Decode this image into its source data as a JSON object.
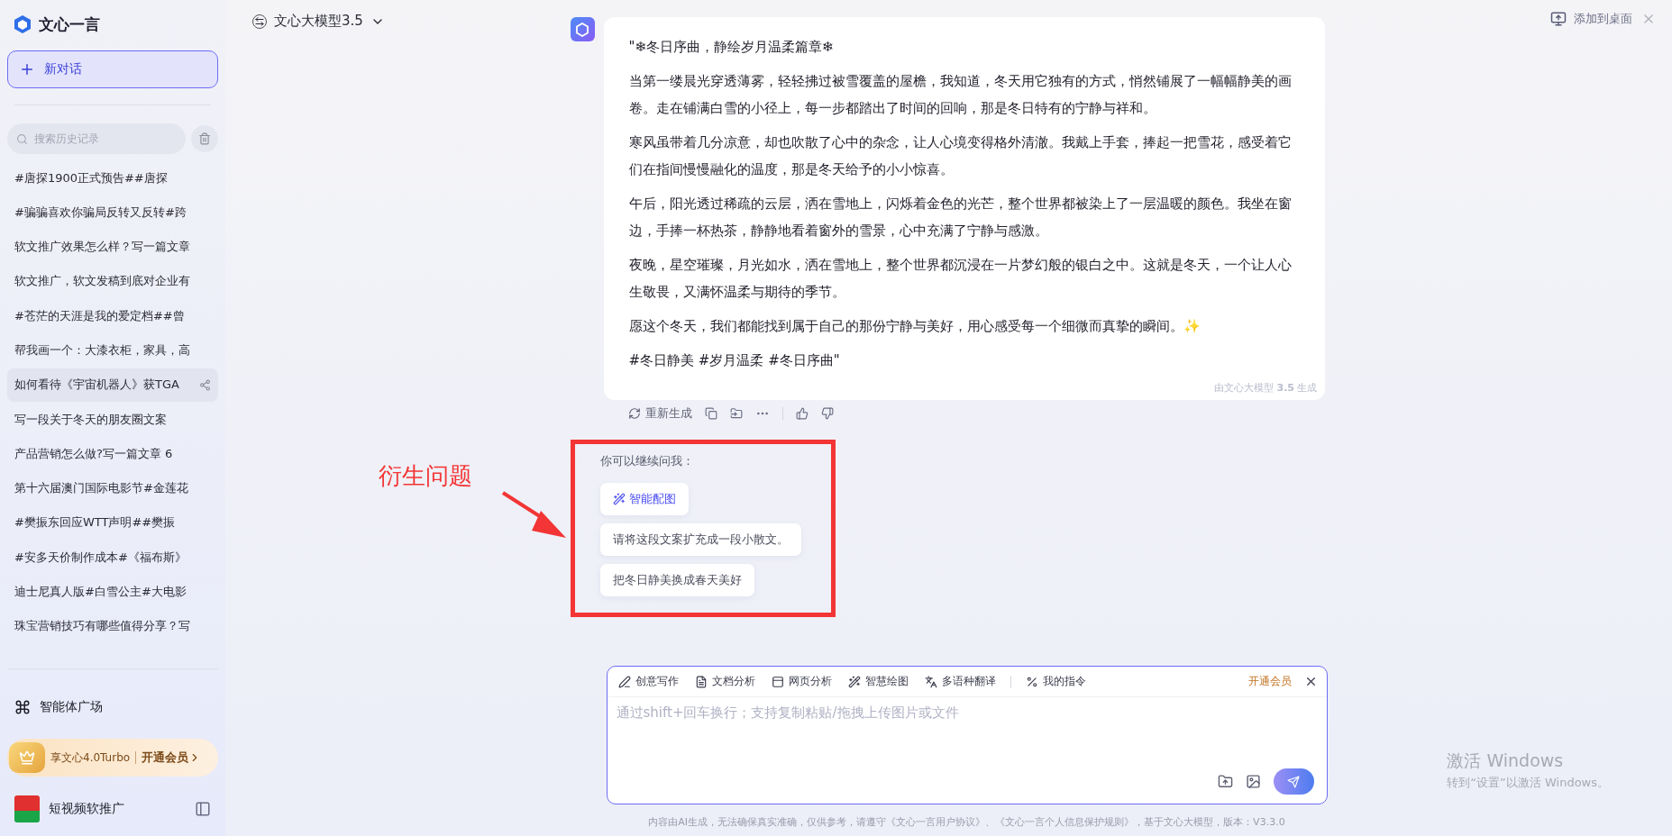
{
  "sidebar": {
    "logo_text": "文心一言",
    "new_chat": "新对话",
    "search": {
      "placeholder": "搜索历史记录"
    },
    "history": [
      {
        "label": "#唐探1900正式预告##唐探",
        "selected": false
      },
      {
        "label": "#骗骗喜欢你骗局反转又反转#跨",
        "selected": false
      },
      {
        "label": "软文推广效果怎么样？写一篇文章",
        "selected": false
      },
      {
        "label": "软文推广，软文发稿到底对企业有",
        "selected": false
      },
      {
        "label": "#苍茫的天涯是我的爱定档##曾",
        "selected": false
      },
      {
        "label": "帮我画一个：大漆衣柜，家具，高",
        "selected": false
      },
      {
        "label": "如何看待《宇宙机器人》获TGA",
        "selected": true
      },
      {
        "label": "写一段关于冬天的朋友圈文案",
        "selected": false
      },
      {
        "label": "产品营销怎么做?写一篇文章 6",
        "selected": false
      },
      {
        "label": "第十六届澳门国际电影节#金莲花",
        "selected": false
      },
      {
        "label": "#樊振东回应WTT声明##樊振",
        "selected": false
      },
      {
        "label": "#安多天价制作成本#《福布斯》",
        "selected": false
      },
      {
        "label": "迪士尼真人版#白雪公主#大电影",
        "selected": false
      },
      {
        "label": "珠宝营销技巧有哪些值得分享？写",
        "selected": false
      }
    ],
    "agent_square": "智能体广场",
    "promo": {
      "text": "享文心4.0Turbo",
      "action": "开通会员"
    },
    "user": {
      "name": "短视频软推广"
    }
  },
  "header": {
    "model": "文心大模型3.5",
    "add_desktop": "添加到桌面"
  },
  "message": {
    "paragraphs": [
      "\"❄冬日序曲，静绘岁月温柔篇章❄",
      "当第一缕晨光穿透薄雾，轻轻拂过被雪覆盖的屋檐，我知道，冬天用它独有的方式，悄然铺展了一幅幅静美的画卷。走在铺满白雪的小径上，每一步都踏出了时间的回响，那是冬日特有的宁静与祥和。",
      "寒风虽带着几分凉意，却也吹散了心中的杂念，让人心境变得格外清澈。我戴上手套，捧起一把雪花，感受着它们在指间慢慢融化的温度，那是冬天给予的小小惊喜。",
      "午后，阳光透过稀疏的云层，洒在雪地上，闪烁着金色的光芒，整个世界都被染上了一层温暖的颜色。我坐在窗边，手捧一杯热茶，静静地看着窗外的雪景，心中充满了宁静与感激。",
      "夜晚，星空璀璨，月光如水，洒在雪地上，整个世界都沉浸在一片梦幻般的银白之中。这就是冬天，一个让人心生敬畏，又满怀温柔与期待的季节。",
      "愿这个冬天，我们都能找到属于自己的那份宁静与美好，用心感受每一个细微而真挚的瞬间。✨",
      "#冬日静美 #岁月温柔 #冬日序曲\""
    ],
    "footer": "由文心大模型 **3.5** 生成",
    "regenerate": "重新生成"
  },
  "followups": {
    "title": "你可以继续问我：",
    "items": [
      {
        "kind": "tool",
        "label": "智能配图"
      },
      {
        "kind": "prompt",
        "label": "请将这段文案扩充成一段小散文。"
      },
      {
        "kind": "prompt",
        "label": "把冬日静美换成春天美好"
      }
    ]
  },
  "annotation": {
    "label": "衍生问题"
  },
  "composer": {
    "tools": [
      {
        "kind": "write",
        "label": "创意写作"
      },
      {
        "kind": "doc",
        "label": "文档分析"
      },
      {
        "kind": "web",
        "label": "网页分析"
      },
      {
        "kind": "draw",
        "label": "智慧绘图"
      },
      {
        "kind": "translate",
        "label": "多语种翻译"
      },
      {
        "kind": "custom",
        "label": "我的指令"
      }
    ],
    "upgrade": "开通会员",
    "placeholder": "通过shift+回车换行；支持复制粘贴/拖拽上传图片或文件"
  },
  "disclaimer": "内容由AI生成，无法确保真实准确，仅供参考，请遵守《文心一言用户协议》、《文心一言个人信息保护规则》，基于文心大模型，版本：V3.3.0",
  "os_watermark": {
    "title": "激活 Windows",
    "subtitle": "转到“设置”以激活 Windows。"
  }
}
